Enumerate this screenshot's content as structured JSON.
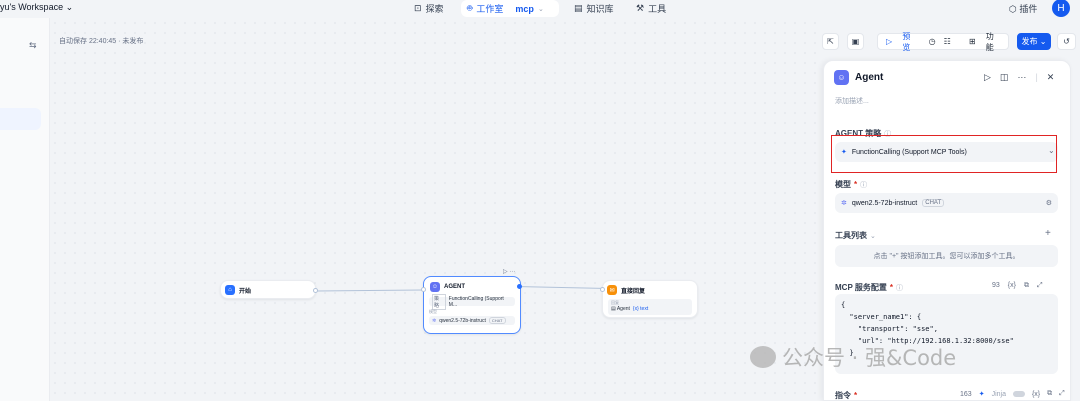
{
  "header": {
    "workspace": "yu's Workspace",
    "nav": [
      {
        "label": "探索",
        "icon": "compass-icon"
      },
      {
        "label": "工作室",
        "icon": "robot-icon"
      },
      {
        "label": "知识库",
        "icon": "book-icon"
      },
      {
        "label": "工具",
        "icon": "tool-icon"
      }
    ],
    "app_name": "mcp",
    "plugin_label": "插件",
    "avatar_letter": "H"
  },
  "canvas": {
    "autosave": "自动保存 22:40:45 · 未发布",
    "toolbar": {
      "preview": "预览",
      "features": "功能",
      "publish": "发布"
    },
    "nodes": {
      "start": {
        "title": "开始"
      },
      "agent": {
        "title": "AGENT",
        "strategy_tag": "策略",
        "strategy": "FunctionCalling (Support M...",
        "model_tag": "模型",
        "model": "qwen2.5-72b-instruct",
        "model_badge": "CHAT"
      },
      "answer": {
        "title": "直接回复",
        "tag": "回复",
        "ref": "Agent",
        "ref_var": "{x} text"
      }
    }
  },
  "panel": {
    "title": "Agent",
    "desc_placeholder": "添加描述...",
    "strategy_label": "AGENT 策略",
    "strategy_value": "FunctionCalling (Support MCP Tools)",
    "model_label": "模型",
    "model_value": "qwen2.5-72b-instruct",
    "model_badge": "CHAT",
    "tools_label": "工具列表",
    "tools_hint": "点击 \"+\" 按钮添加工具。您可以添加多个工具。",
    "mcp_label": "MCP 服务配置",
    "mcp_count": "93",
    "mcp_var": "{x}",
    "mcp_code": "{\n  \"server_name1\": {\n    \"transport\": \"sse\",\n    \"url\": \"http://192.168.1.32:8000/sse\"\n  }",
    "instruction_label": "指令",
    "instruction_count": "163",
    "jinja_label": "Jinja"
  },
  "watermark": "公众号 · 强&Code",
  "colors": {
    "primary": "#155aef",
    "highlight_box": "#e02424",
    "agent_icon": "#6172f3",
    "answer_icon": "#f79009",
    "start_icon": "#2970ff"
  }
}
